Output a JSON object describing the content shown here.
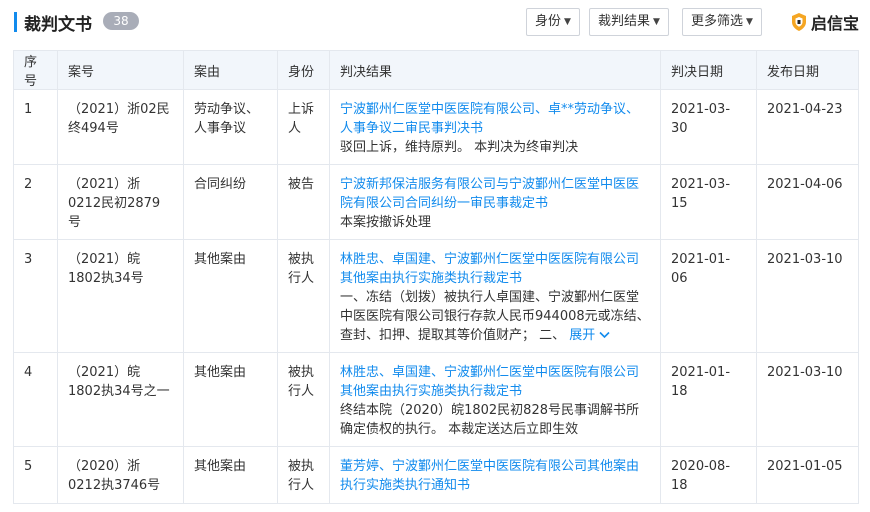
{
  "header": {
    "title": "裁判文书",
    "count": "38",
    "filters": [
      {
        "label": "身份"
      },
      {
        "label": "裁判结果"
      },
      {
        "label": "更多筛选"
      }
    ],
    "brand": "启信宝"
  },
  "table": {
    "columns": [
      "序号",
      "案号",
      "案由",
      "身份",
      "判决结果",
      "判决日期",
      "发布日期"
    ],
    "rows": [
      {
        "seq": "1",
        "case_no": "（2021）浙02民终494号",
        "cause": "劳动争议、人事争议",
        "role": "上诉人",
        "result_title": "宁波鄞州仁医堂中医医院有限公司、卓**劳动争议、人事争议二审民事判决书",
        "result_desc": "驳回上诉，维持原判。 本判决为终审判决",
        "judgment_date": "2021-03-30",
        "publish_date": "2021-04-23"
      },
      {
        "seq": "2",
        "case_no": "（2021）浙0212民初2879号",
        "cause": "合同纠纷",
        "role": "被告",
        "result_title": "宁波新邦保洁服务有限公司与宁波鄞州仁医堂中医医院有限公司合同纠纷一审民事裁定书",
        "result_desc": "本案按撤诉处理",
        "judgment_date": "2021-03-15",
        "publish_date": "2021-04-06"
      },
      {
        "seq": "3",
        "case_no": "（2021）皖1802执34号",
        "cause": "其他案由",
        "role": "被执行人",
        "result_title": "林胜忠、卓国建、宁波鄞州仁医堂中医医院有限公司其他案由执行实施类执行裁定书",
        "result_desc": "一、冻结（划拨）被执行人卓国建、宁波鄞州仁医堂中医医院有限公司银行存款人民币944008元或冻结、查封、扣押、提取其等价值财产； 二、",
        "expand_label": "展开",
        "judgment_date": "2021-01-06",
        "publish_date": "2021-03-10"
      },
      {
        "seq": "4",
        "case_no": "（2021）皖1802执34号之一",
        "cause": "其他案由",
        "role": "被执行人",
        "result_title": "林胜忠、卓国建、宁波鄞州仁医堂中医医院有限公司其他案由执行实施类执行裁定书",
        "result_desc": "终结本院（2020）皖1802民初828号民事调解书所确定债权的执行。 本裁定送达后立即生效",
        "judgment_date": "2021-01-18",
        "publish_date": "2021-03-10"
      },
      {
        "seq": "5",
        "case_no": "（2020）浙0212执3746号",
        "cause": "其他案由",
        "role": "被执行人",
        "result_title": "董芳婷、宁波鄞州仁医堂中医医院有限公司其他案由执行实施类执行通知书",
        "result_desc": "",
        "judgment_date": "2020-08-18",
        "publish_date": "2021-01-05"
      }
    ]
  },
  "colors": {
    "accent": "#128bed",
    "header_bg": "#f2f6fb",
    "badge": "#a9adb8",
    "brand_orange": "#f5a623"
  }
}
